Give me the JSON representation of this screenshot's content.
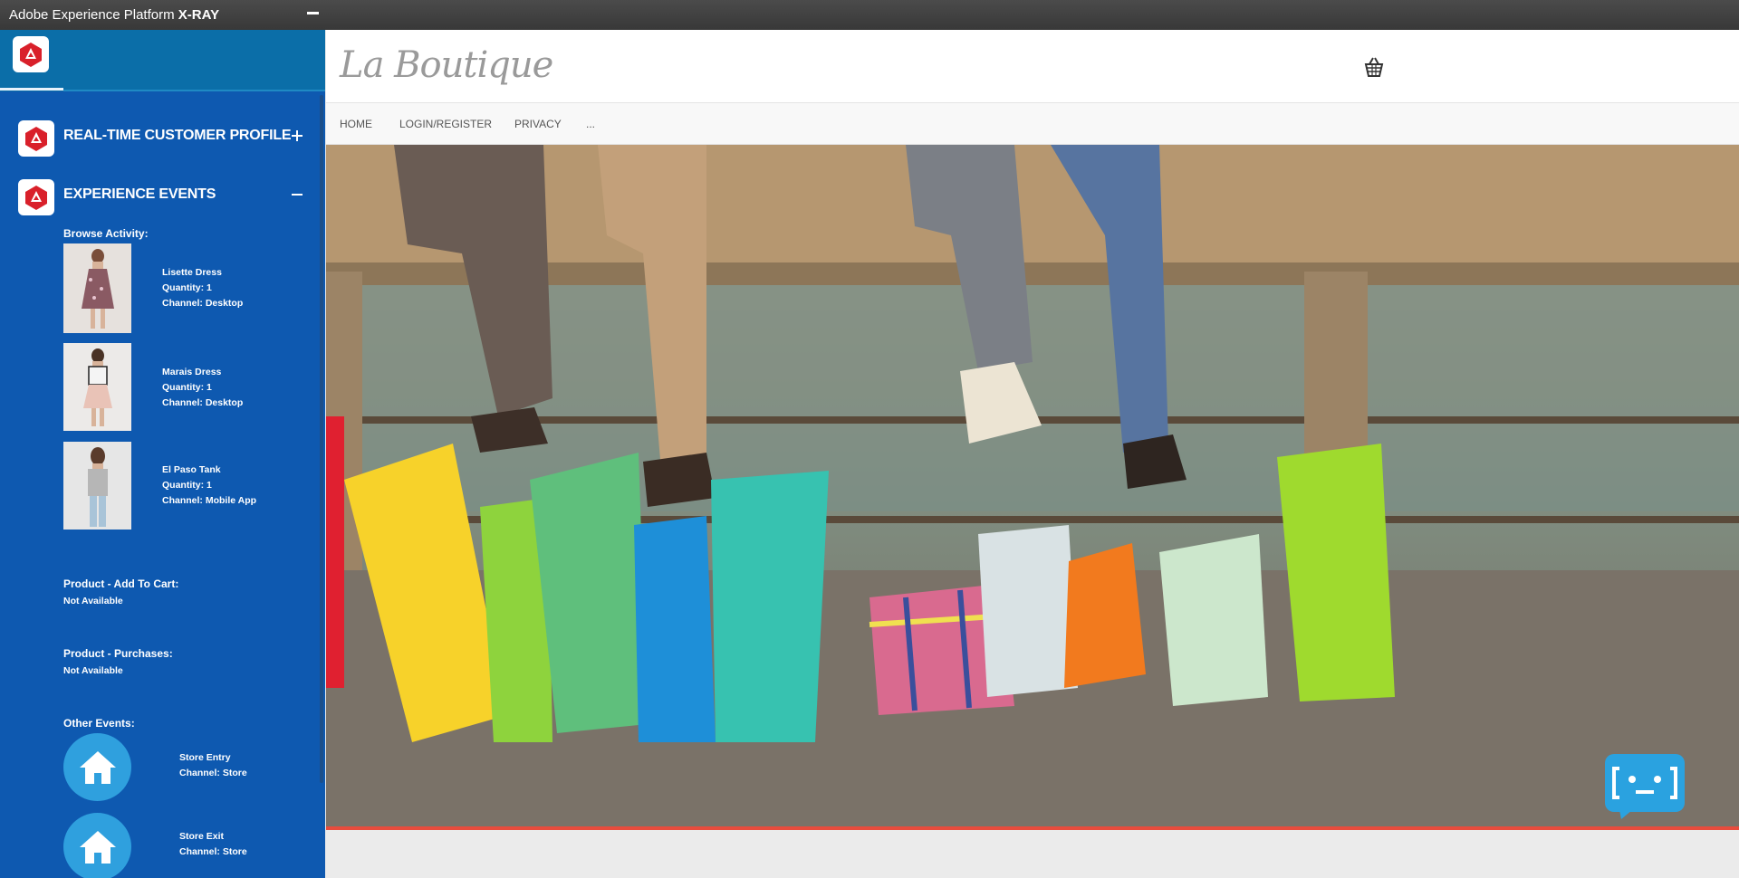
{
  "window": {
    "title_prefix": "Adobe Experience Platform",
    "title_bold": "X-RAY"
  },
  "xray": {
    "sections": [
      {
        "label": "REAL-TIME CUSTOMER PROFILE",
        "state": "collapsed"
      },
      {
        "label": "EXPERIENCE EVENTS",
        "state": "expanded"
      }
    ],
    "browse_heading": "Browse Activity:",
    "browse_items": [
      {
        "name": "Lisette Dress",
        "quantity": "Quantity: 1",
        "channel": "Channel: Desktop"
      },
      {
        "name": "Marais Dress",
        "quantity": "Quantity: 1",
        "channel": "Channel: Desktop"
      },
      {
        "name": "El Paso Tank",
        "quantity": "Quantity: 1",
        "channel": "Channel: Mobile App"
      }
    ],
    "add_to_cart": {
      "heading": "Product - Add To Cart:",
      "value": "Not Available"
    },
    "purchases": {
      "heading": "Product - Purchases:",
      "value": "Not Available"
    },
    "other_heading": "Other Events:",
    "other_events": [
      {
        "name": "Store Entry",
        "channel": "Channel: Store",
        "icon": "home-icon"
      },
      {
        "name": "Store Exit",
        "channel": "Channel: Store",
        "icon": "home-icon"
      }
    ]
  },
  "store": {
    "brand": "La Boutique",
    "nav": [
      "HOME",
      "LOGIN/REGISTER",
      "PRIVACY",
      "..."
    ],
    "colors": {
      "panel_blue": "#0e59b0",
      "accent_red": "#e84c3d",
      "bot_blue": "#2aa2e0"
    }
  }
}
